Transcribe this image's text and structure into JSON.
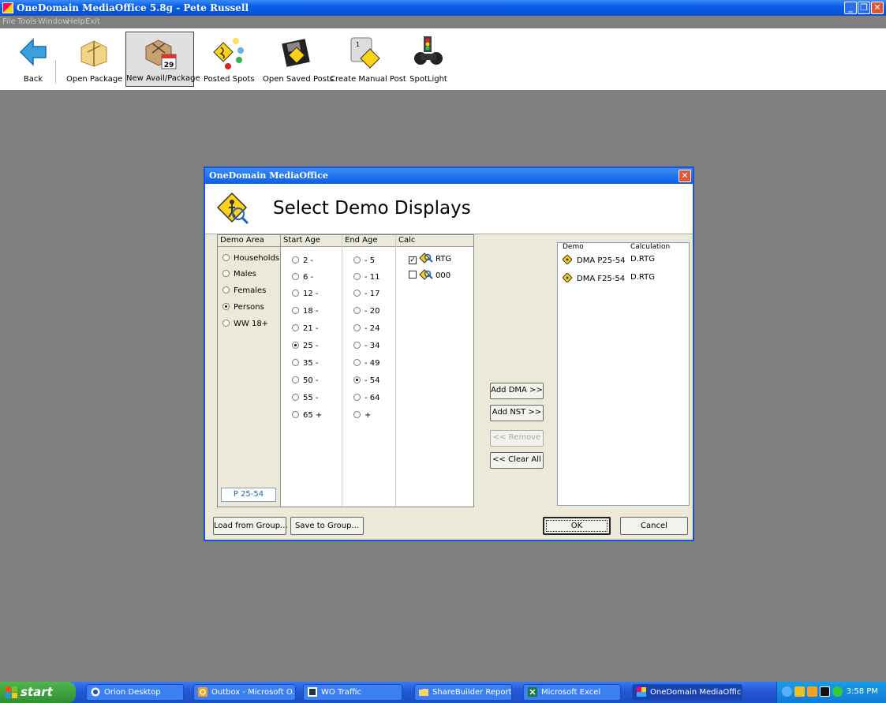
{
  "window": {
    "title": "OneDomain MediaOffice 5.8g - Pete Russell"
  },
  "menu": [
    "File",
    "Tools",
    "Window",
    "Help",
    "Exit"
  ],
  "toolbar": {
    "items": [
      {
        "label": "Back",
        "icon": "back-arrow-icon"
      },
      {
        "label": "Open Package",
        "icon": "open-package-icon"
      },
      {
        "label": "New Avail/Package",
        "icon": "new-package-icon",
        "active": true
      },
      {
        "label": "Posted Spots",
        "icon": "posted-spots-icon"
      },
      {
        "label": "Open Saved Posts",
        "icon": "open-saved-posts-icon"
      },
      {
        "label": "Create Manual Post",
        "icon": "manual-post-icon"
      },
      {
        "label": "SpotLight",
        "icon": "spotlight-icon"
      }
    ],
    "calendar_day": "29"
  },
  "dialog": {
    "title": "OneDomain MediaOffice",
    "heading": "Select Demo Displays",
    "columns": {
      "area": "Demo Area",
      "start": "Start Age",
      "end": "End Age",
      "calc": "Calc"
    },
    "demo_areas": [
      {
        "label": "Households",
        "selected": false
      },
      {
        "label": "Males",
        "selected": false
      },
      {
        "label": "Females",
        "selected": false
      },
      {
        "label": "Persons",
        "selected": true
      },
      {
        "label": "WW 18+",
        "selected": false
      }
    ],
    "start_ages": [
      {
        "label": "2 -",
        "selected": false
      },
      {
        "label": "6 -",
        "selected": false
      },
      {
        "label": "12 -",
        "selected": false
      },
      {
        "label": "18 -",
        "selected": false
      },
      {
        "label": "21 -",
        "selected": false
      },
      {
        "label": "25 -",
        "selected": true
      },
      {
        "label": "35 -",
        "selected": false
      },
      {
        "label": "50 -",
        "selected": false
      },
      {
        "label": "55 -",
        "selected": false
      },
      {
        "label": "65 +",
        "selected": false
      }
    ],
    "end_ages": [
      {
        "label": "- 5",
        "selected": false
      },
      {
        "label": "- 11",
        "selected": false
      },
      {
        "label": "- 17",
        "selected": false
      },
      {
        "label": "- 20",
        "selected": false
      },
      {
        "label": "- 24",
        "selected": false
      },
      {
        "label": "- 34",
        "selected": false
      },
      {
        "label": "- 49",
        "selected": false
      },
      {
        "label": "- 54",
        "selected": true
      },
      {
        "label": "- 64",
        "selected": false
      },
      {
        "label": "+",
        "selected": false
      }
    ],
    "calcs": [
      {
        "label": "RTG",
        "checked": true
      },
      {
        "label": "000",
        "checked": false
      }
    ],
    "current_demo": "P 25-54",
    "buttons": {
      "add_dma": "Add DMA >>",
      "add_nst": "Add NST >>",
      "remove": "<< Remove",
      "clear_all": "<< Clear All",
      "load_group": "Load from Group...",
      "save_group": "Save to Group...",
      "ok": "OK",
      "cancel": "Cancel"
    },
    "list": {
      "headers": {
        "demo": "Demo",
        "calc": "Calculation"
      },
      "rows": [
        {
          "demo": "DMA P25-54",
          "calc": "D.RTG"
        },
        {
          "demo": "DMA F25-54",
          "calc": "D.RTG"
        }
      ]
    }
  },
  "taskbar": {
    "start": "start",
    "tasks": [
      {
        "label": "Orion Desktop"
      },
      {
        "label": "Outbox - Microsoft O..."
      },
      {
        "label": "WO Traffic"
      },
      {
        "label": "ShareBuilder Reports"
      },
      {
        "label": "Microsoft Excel"
      },
      {
        "label": "OneDomain MediaOffice",
        "active": true
      }
    ],
    "clock": "3:58 PM"
  },
  "colors": {
    "titlebar": "#0a5ee8",
    "desktop": "#808080",
    "dialog": "#ece9d8",
    "close": "#e2553a"
  }
}
